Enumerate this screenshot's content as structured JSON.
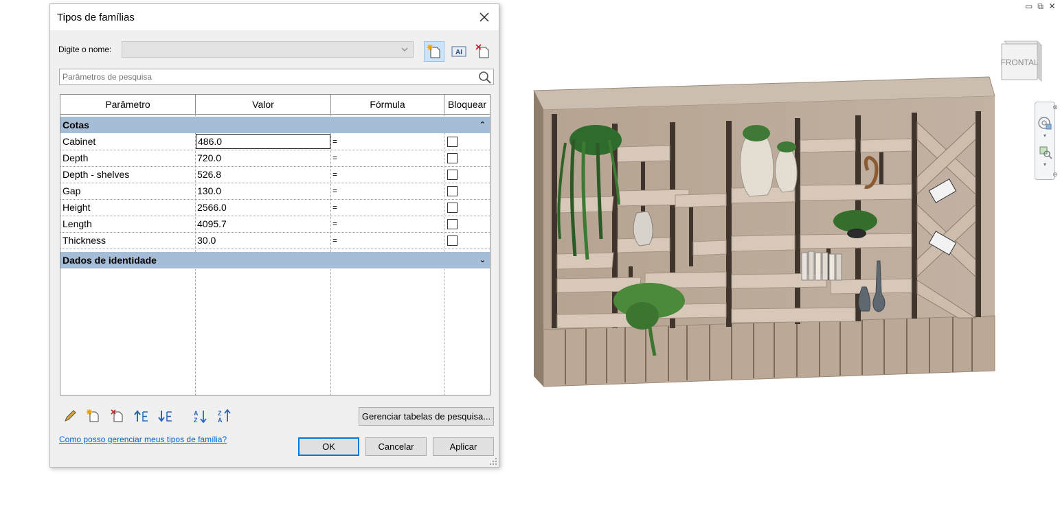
{
  "dialog": {
    "title": "Tipos de famílias",
    "name_label": "Digite o nome:",
    "name_value": "",
    "search_placeholder": "Parâmetros de pesquisa",
    "columns": [
      "Parâmetro",
      "Valor",
      "Fórmula",
      "Bloquear"
    ],
    "groups": [
      {
        "name": "Cotas",
        "expanded": true,
        "rows": [
          {
            "param": "Cabinet",
            "value": "486.0",
            "formula": "=",
            "locked": false
          },
          {
            "param": "Depth",
            "value": "720.0",
            "formula": "=",
            "locked": false
          },
          {
            "param": "Depth - shelves",
            "value": "526.8",
            "formula": "=",
            "locked": false
          },
          {
            "param": "Gap",
            "value": "130.0",
            "formula": "=",
            "locked": false
          },
          {
            "param": "Height",
            "value": "2566.0",
            "formula": "=",
            "locked": false
          },
          {
            "param": "Length",
            "value": "4095.7",
            "formula": "=",
            "locked": false
          },
          {
            "param": "Thickness",
            "value": "30.0",
            "formula": "=",
            "locked": false
          }
        ]
      },
      {
        "name": "Dados de identidade",
        "expanded": false,
        "rows": []
      }
    ],
    "manage_lookup_label": "Gerenciar tabelas de pesquisa...",
    "help_link": "Como posso gerenciar meus tipos de família?",
    "ok_label": "OK",
    "cancel_label": "Cancelar",
    "apply_label": "Aplicar"
  },
  "viewport": {
    "viewcube_label": "FRONTAL"
  },
  "colors": {
    "group_header": "#a6bdd7",
    "link": "#0066cc",
    "default_button_border": "#0078d7",
    "wood": "#b8a594"
  },
  "icons": {
    "title": "close-icon",
    "toolbar": [
      "new-type-icon",
      "rename-type-icon",
      "delete-type-icon"
    ],
    "bottom": [
      "edit-parameter-icon",
      "new-parameter-icon",
      "delete-parameter-icon",
      "move-up-icon",
      "move-down-icon",
      "sort-ascending-icon",
      "sort-descending-icon"
    ]
  }
}
